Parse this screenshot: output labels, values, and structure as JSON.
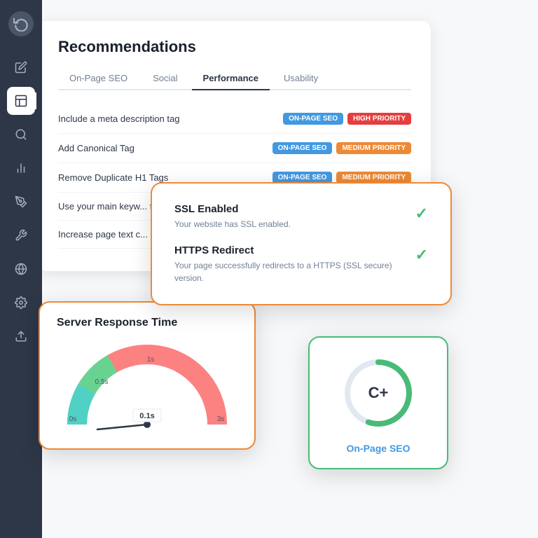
{
  "sidebar": {
    "logo_icon": "⟳",
    "items": [
      {
        "icon": "✏",
        "name": "edit",
        "active": false
      },
      {
        "icon": "📄",
        "name": "pages",
        "active": true
      },
      {
        "icon": "🔍",
        "name": "search",
        "active": false
      },
      {
        "icon": "📊",
        "name": "analytics",
        "active": false
      },
      {
        "icon": "✒",
        "name": "pen",
        "active": false
      },
      {
        "icon": "⚙",
        "name": "settings-tool",
        "active": false
      },
      {
        "icon": "🌐",
        "name": "globe",
        "active": false
      },
      {
        "icon": "⚙",
        "name": "gear",
        "active": false
      },
      {
        "icon": "↑",
        "name": "upload",
        "active": false
      }
    ]
  },
  "recommendations": {
    "title": "Recommendations",
    "tabs": [
      {
        "label": "On-Page SEO",
        "active": false
      },
      {
        "label": "Social",
        "active": false
      },
      {
        "label": "Performance",
        "active": true
      },
      {
        "label": "Usability",
        "active": false
      }
    ],
    "rows": [
      {
        "label": "Include a meta description tag",
        "badges": [
          {
            "text": "On-Page SEO",
            "type": "seo"
          },
          {
            "text": "High Priority",
            "type": "high"
          }
        ]
      },
      {
        "label": "Add Canonical Tag",
        "badges": [
          {
            "text": "On-Page SEO",
            "type": "seo"
          },
          {
            "text": "Medium Priority",
            "type": "medium"
          }
        ]
      },
      {
        "label": "Remove Duplicate H1 Tags",
        "badges": [
          {
            "text": "On-Page SEO",
            "type": "seo"
          },
          {
            "text": "Medium Priority",
            "type": "medium"
          }
        ]
      },
      {
        "label": "Use your main keyw... tags",
        "badges": []
      },
      {
        "label": "Increase page text c...",
        "badges": []
      }
    ]
  },
  "ssl_card": {
    "items": [
      {
        "title": "SSL Enabled",
        "description": "Your website has SSL enabled.",
        "status": "pass"
      },
      {
        "title": "HTTPS Redirect",
        "description": "Your page successfully redirects to a HTTPS (SSL secure) version.",
        "status": "pass"
      }
    ]
  },
  "server_card": {
    "title": "Server Response Time",
    "value": "0.1s",
    "labels": [
      "0s",
      "0.5s",
      "1s",
      "3s"
    ]
  },
  "seo_circle_card": {
    "grade": "C+",
    "label": "On-Page SEO",
    "progress": 55
  }
}
